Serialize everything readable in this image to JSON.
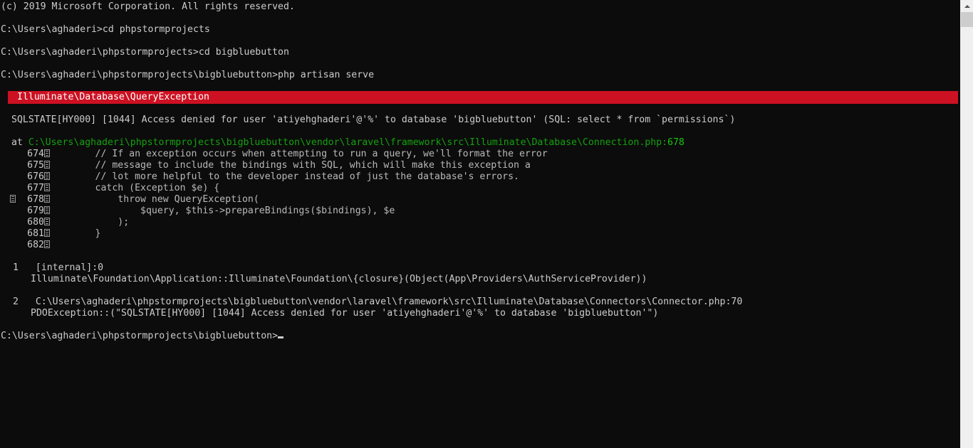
{
  "window": {
    "background_color": "#0c0c0c",
    "foreground_color": "#cccccc",
    "accent_error_color": "#cc1122",
    "path_color": "#13a10e",
    "frame_number_color": "#c19c00"
  },
  "console": {
    "copyright_line": "(c) 2019 Microsoft Corporation. All rights reserved.",
    "commands": [
      {
        "prompt": "C:\\Users\\aghaderi>",
        "command": "cd phpstormprojects"
      },
      {
        "prompt": "C:\\Users\\aghaderi\\phpstormprojects>",
        "command": "cd bigbluebutton"
      },
      {
        "prompt": "C:\\Users\\aghaderi\\phpstormprojects\\bigbluebutton>",
        "command": "php artisan serve"
      }
    ],
    "final_prompt": "C:\\Users\\aghaderi\\phpstormprojects\\bigbluebutton>"
  },
  "exception": {
    "banner_label": "Illuminate\\Database\\QueryException",
    "message": "SQLSTATE[HY000] [1044] Access denied for user 'atiyehghaderi'@'%' to database 'bigbluebutton' (SQL: select * from `permissions`)",
    "at_keyword": "at",
    "at_path": "C:\\Users\\aghaderi\\phpstormprojects\\bigbluebutton\\vendor\\laravel\\framework\\src\\Illuminate\\Database\\Connection.php",
    "at_line_separator": ":",
    "at_line_number": "678"
  },
  "code_listing": {
    "highlighted_line": "678",
    "lines": [
      {
        "number": "674",
        "text": "        // If an exception occurs when attempting to run a query, we'll format the error"
      },
      {
        "number": "675",
        "text": "        // message to include the bindings with SQL, which will make this exception a"
      },
      {
        "number": "676",
        "text": "        // lot more helpful to the developer instead of just the database's errors."
      },
      {
        "number": "677",
        "text": "        catch (Exception $e) {"
      },
      {
        "number": "678",
        "text": "            throw new QueryException("
      },
      {
        "number": "679",
        "text": "                $query, $this->prepareBindings($bindings), $e"
      },
      {
        "number": "680",
        "text": "            );"
      },
      {
        "number": "681",
        "text": "        }"
      },
      {
        "number": "682",
        "text": ""
      }
    ]
  },
  "stack_trace": {
    "frames": [
      {
        "index": "1",
        "location": "[internal]:0",
        "detail": "Illuminate\\Foundation\\Application::Illuminate\\Foundation\\{closure}(Object(App\\Providers\\AuthServiceProvider))"
      },
      {
        "index": "2",
        "location": "C:\\Users\\aghaderi\\phpstormprojects\\bigbluebutton\\vendor\\laravel\\framework\\src\\Illuminate\\Database\\Connectors\\Connector.php:70",
        "detail": "PDOException::(\"SQLSTATE[HY000] [1044] Access denied for user 'atiyehghaderi'@'%' to database 'bigbluebutton'\")"
      }
    ]
  },
  "scrollbar": {
    "up_arrow_icon": "chevron-up-icon",
    "thumb_position": "top"
  }
}
